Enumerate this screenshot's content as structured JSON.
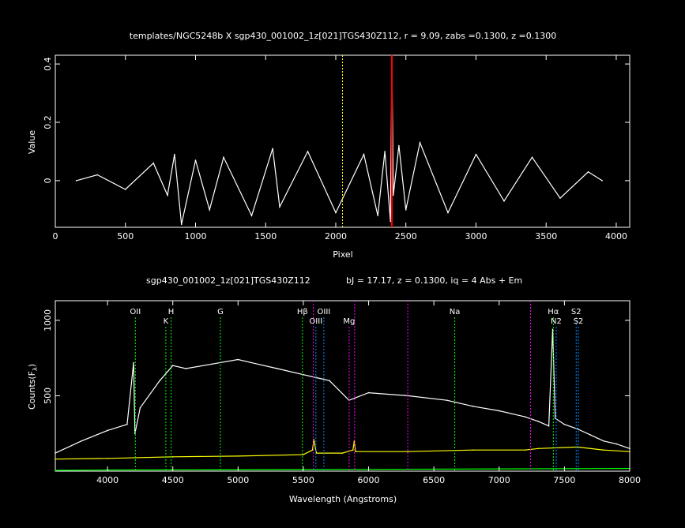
{
  "chart_data": [
    {
      "type": "line",
      "title": "templates/NGC5248b X sgp430_001002_1z[021]TGS430Z112, r =  9.09, zabs =0.1300, z =0.1300",
      "xlabel": "Pixel",
      "ylabel": "Value",
      "xlim": [
        0,
        4096
      ],
      "ylim": [
        -0.16,
        0.43
      ],
      "xticks": [
        0,
        500,
        1000,
        1500,
        2000,
        2500,
        3000,
        3500,
        4000
      ],
      "xtick_labels": [
        "0",
        "500",
        "1000",
        "1500",
        "2000",
        "2500",
        "3000",
        "3500",
        "4000"
      ],
      "yticks": [
        0,
        0.2,
        0.4
      ],
      "ytick_labels": [
        "0",
        "0.2",
        "0.4"
      ],
      "center_marker_x": 2048,
      "peak": {
        "x": 2400,
        "y": 0.42
      },
      "series": [
        {
          "color": "#ffffff",
          "x": [
            150,
            300,
            500,
            700,
            800,
            850,
            900,
            1000,
            1100,
            1200,
            1400,
            1550,
            1600,
            1800,
            2000,
            2200,
            2300,
            2350,
            2390,
            2400,
            2410,
            2450,
            2500,
            2600,
            2800,
            3000,
            3200,
            3400,
            3600,
            3800,
            3900
          ],
          "values": [
            0.0,
            0.02,
            -0.03,
            0.06,
            -0.05,
            0.09,
            -0.15,
            0.07,
            -0.1,
            0.08,
            -0.12,
            0.11,
            -0.09,
            0.1,
            -0.11,
            0.09,
            -0.12,
            0.1,
            -0.14,
            0.42,
            -0.05,
            0.12,
            -0.1,
            0.13,
            -0.11,
            0.09,
            -0.07,
            0.08,
            -0.06,
            0.03,
            0.0
          ]
        }
      ],
      "colors": {
        "trace": "#ffffff",
        "center": "#ffff00",
        "peak": "#ff0000"
      }
    },
    {
      "type": "line",
      "title": "sgp430_001002_1z[021]TGS430Z112",
      "subtitle": "bJ = 17.17, z = 0.1300, iq =  4 Abs + Em",
      "xlabel": "Wavelength (Angstroms)",
      "ylabel": "Counts(F",
      "ylabel_sub": "λ",
      "ylabel_end": ")",
      "xlim": [
        3600,
        8000
      ],
      "ylim": [
        0,
        1130
      ],
      "xticks": [
        4000,
        4500,
        5000,
        5500,
        6000,
        6500,
        7000,
        7500,
        8000
      ],
      "xtick_labels": [
        "4000",
        "4500",
        "5000",
        "5500",
        "6000",
        "6500",
        "7000",
        "7500",
        "8000"
      ],
      "yticks": [
        500,
        1000
      ],
      "ytick_labels": [
        "500",
        "1000"
      ],
      "series": [
        {
          "color": "#ffffff",
          "x": [
            3600,
            3800,
            4000,
            4150,
            4200,
            4210,
            4250,
            4400,
            4500,
            4600,
            4800,
            5000,
            5100,
            5300,
            5500,
            5600,
            5700,
            5850,
            6000,
            6300,
            6600,
            6800,
            7000,
            7200,
            7300,
            7380,
            7410,
            7430,
            7500,
            7600,
            7700,
            7800,
            7900,
            8000
          ],
          "values": [
            120,
            200,
            270,
            310,
            720,
            250,
            420,
            600,
            700,
            680,
            710,
            740,
            720,
            680,
            640,
            620,
            600,
            470,
            520,
            500,
            470,
            430,
            400,
            360,
            330,
            300,
            940,
            350,
            310,
            280,
            240,
            200,
            180,
            150
          ]
        },
        {
          "color": "#ffff00",
          "x": [
            3600,
            4000,
            4500,
            5000,
            5500,
            5570,
            5580,
            5600,
            5800,
            5880,
            5890,
            5900,
            6300,
            6800,
            7200,
            7300,
            7600,
            7800,
            8000
          ],
          "values": [
            80,
            85,
            95,
            100,
            110,
            140,
            210,
            120,
            120,
            140,
            200,
            130,
            130,
            140,
            140,
            150,
            160,
            140,
            130
          ]
        },
        {
          "color": "#00ff00",
          "x": [
            3600,
            4000,
            5000,
            6000,
            7000,
            8000
          ],
          "values": [
            5,
            8,
            10,
            12,
            15,
            18
          ]
        }
      ],
      "lines": [
        {
          "label": "OII",
          "wl": 4213,
          "row": 1,
          "color": "#00ff00"
        },
        {
          "label": "K",
          "wl": 4447,
          "row": 2,
          "color": "#00ff00"
        },
        {
          "label": "H",
          "wl": 4487,
          "row": 1,
          "color": "#00ff00"
        },
        {
          "label": "G",
          "wl": 4865,
          "row": 1,
          "color": "#00ff00"
        },
        {
          "label": "Hβ",
          "wl": 5493,
          "row": 1,
          "color": "#00ff00"
        },
        {
          "label": "OIII",
          "wl": 5596,
          "row": 2,
          "color": "#0088ff"
        },
        {
          "label": "OIII",
          "wl": 5657,
          "row": 1,
          "color": "#0088ff"
        },
        {
          "label": "Mg",
          "wl": 5851,
          "row": 2,
          "color": "#ff00ff"
        },
        {
          "label": "Na",
          "wl": 6660,
          "row": 1,
          "color": "#00ff00"
        },
        {
          "label": "Hα",
          "wl": 7415,
          "row": 1,
          "color": "#00ff00"
        },
        {
          "label": "N2",
          "wl": 7437,
          "row": 2,
          "color": "#0088ff"
        },
        {
          "label": "S2",
          "wl": 7590,
          "row": 1,
          "color": "#0088ff"
        },
        {
          "label": "S2",
          "wl": 7607,
          "row": 2,
          "color": "#0088ff"
        }
      ],
      "extra_lines": [
        {
          "wl": 5577,
          "color": "#ff00ff"
        },
        {
          "wl": 5893,
          "color": "#ff00ff"
        },
        {
          "wl": 6300,
          "color": "#ff00ff"
        },
        {
          "wl": 7240,
          "color": "#ff00ff"
        }
      ]
    }
  ]
}
